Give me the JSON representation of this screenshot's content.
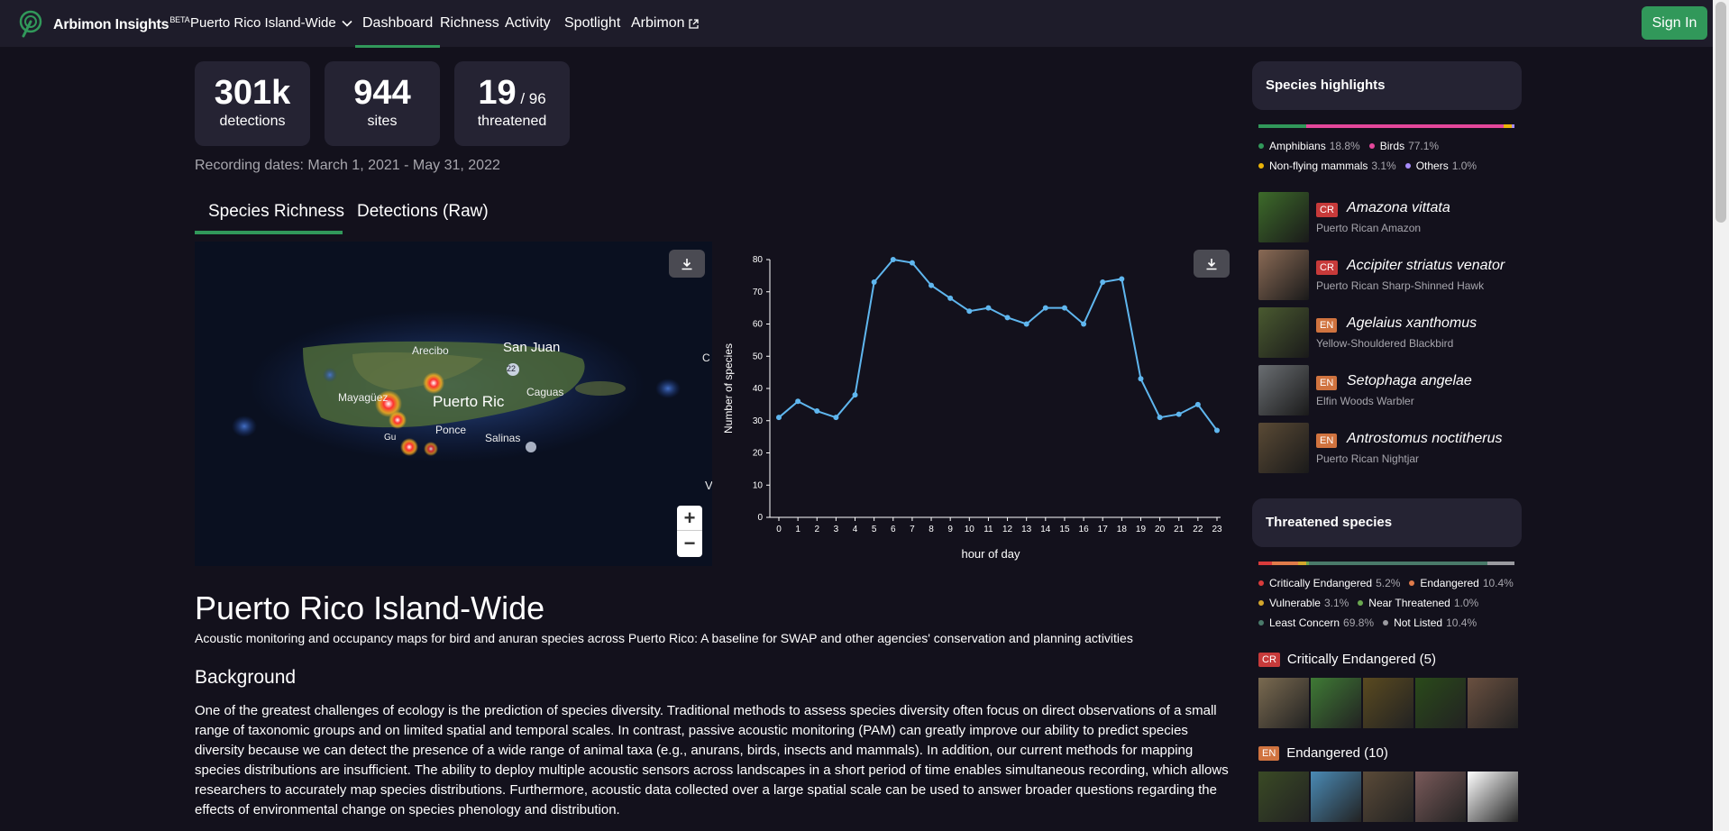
{
  "nav": {
    "brand": "Arbimon Insights",
    "brand_sup": "BETA",
    "project": "Puerto Rico Island-Wide",
    "links": [
      "Dashboard",
      "Richness",
      "Activity",
      "Spotlight",
      "Arbimon"
    ],
    "sign_in": "Sign In"
  },
  "stats": [
    {
      "value": "301k",
      "suffix": "",
      "label": "detections"
    },
    {
      "value": "944",
      "suffix": "",
      "label": "sites"
    },
    {
      "value": "19",
      "suffix": " / 96",
      "label": "threatened"
    }
  ],
  "recording_dates": "Recording dates: March 1, 2021 - May 31, 2022",
  "tabs": [
    "Species Richness",
    "Detections (Raw)"
  ],
  "map": {
    "labels": [
      "Arecibo",
      "San Juan",
      "Mayagüez",
      "Puerto Ric",
      "Caguas",
      "Ponce",
      "Salinas",
      "Gu",
      "22",
      "C",
      "V"
    ],
    "zoom_in": "+",
    "zoom_out": "−"
  },
  "chart_data": {
    "type": "line",
    "x": [
      0,
      1,
      2,
      3,
      4,
      5,
      6,
      7,
      8,
      9,
      10,
      11,
      12,
      13,
      14,
      15,
      16,
      17,
      18,
      19,
      20,
      21,
      22,
      23
    ],
    "values": [
      31,
      36,
      33,
      31,
      38,
      73,
      80,
      79,
      72,
      68,
      64,
      65,
      62,
      60,
      65,
      65,
      60,
      73,
      74,
      43,
      31,
      32,
      35,
      27
    ],
    "xlabel": "hour of day",
    "ylabel": "Number of species",
    "ylim": [
      0,
      80
    ],
    "yticks": [
      0,
      10,
      20,
      30,
      40,
      50,
      60,
      70,
      80
    ],
    "color": "#5fb6ee"
  },
  "project": {
    "title": "Puerto Rico Island-Wide",
    "subtitle": "Acoustic monitoring and occupancy maps for bird and anuran species across Puerto Rico: A baseline for SWAP and other agencies' conservation and planning activities",
    "background_heading": "Background",
    "background_text": "One of the greatest challenges of ecology is the prediction of species diversity. Traditional methods to assess species diversity often focus on direct observations of a small range of taxonomic groups and on limited spatial and temporal scales. In contrast, passive acoustic monitoring (PAM) can greatly improve our ability to predict species diversity because we can detect the presence of a wide range of animal taxa (e.g., anurans, birds, insects and mammals). In addition, our current methods for mapping species distributions are insufficient. The ability to deploy multiple acoustic sensors across landscapes in a short period of time enables simultaneous recording, which allows researchers to accurately map species distributions. Furthermore, acoustic data collected over a large spatial scale can be used to answer broader questions regarding the effects of environmental change on species phenology and distribution."
  },
  "highlights": {
    "title": "Species highlights",
    "groups": [
      {
        "name": "Amphibians",
        "pct": "18.8%",
        "value": 18.8,
        "color": "#31985a"
      },
      {
        "name": "Birds",
        "pct": "77.1%",
        "value": 77.1,
        "color": "#e4479b"
      },
      {
        "name": "Non-flying mammals",
        "pct": "3.1%",
        "value": 3.1,
        "color": "#eab308"
      },
      {
        "name": "Others",
        "pct": "1.0%",
        "value": 1.0,
        "color": "#a78bfa"
      }
    ],
    "species": [
      {
        "status": "CR",
        "scientific": "Amazona vittata",
        "common": "Puerto Rican Amazon",
        "img": "#3d6b2a"
      },
      {
        "status": "CR",
        "scientific": "Accipiter striatus venator",
        "common": "Puerto Rican Sharp-Shinned Hawk",
        "img": "#8a6a55"
      },
      {
        "status": "EN",
        "scientific": "Agelaius xanthomus",
        "common": "Yellow-Shouldered Blackbird",
        "img": "#4a5a30"
      },
      {
        "status": "EN",
        "scientific": "Setophaga angelae",
        "common": "Elfin Woods Warbler",
        "img": "#6a6e72"
      },
      {
        "status": "EN",
        "scientific": "Antrostomus noctitherus",
        "common": "Puerto Rican Nightjar",
        "img": "#5a4a35"
      }
    ]
  },
  "threatened": {
    "title": "Threatened species",
    "categories": [
      {
        "name": "Critically Endangered",
        "pct": "5.2%",
        "value": 5.2,
        "color": "#d93b3b"
      },
      {
        "name": "Endangered",
        "pct": "10.4%",
        "value": 10.4,
        "color": "#e07b4a"
      },
      {
        "name": "Vulnerable",
        "pct": "3.1%",
        "value": 3.1,
        "color": "#d4a72c"
      },
      {
        "name": "Near Threatened",
        "pct": "1.0%",
        "value": 1.0,
        "color": "#6aa84f"
      },
      {
        "name": "Least Concern",
        "pct": "69.8%",
        "value": 69.8,
        "color": "#4a7a6a"
      },
      {
        "name": "Not Listed",
        "pct": "10.4%",
        "value": 10.4,
        "color": "#9a9aa0"
      }
    ],
    "cr_badge": "CR",
    "cr_label": "Critically Endangered (5)",
    "en_badge": "EN",
    "en_label": "Endangered (10)",
    "cr_thumbs": [
      "#7a6a50",
      "#3f7a35",
      "#5a4a20",
      "#2a4a1a",
      "#6a5040"
    ],
    "en_thumbs": [
      "#3a4a25",
      "#4a8ab5",
      "#5a4a38",
      "#7a5a5a",
      "#ffffff"
    ]
  },
  "colors": {
    "accent": "#31985a",
    "cr": "#c73a3a",
    "en": "#d0733f",
    "panel": "#252333",
    "background": "#13111c"
  }
}
